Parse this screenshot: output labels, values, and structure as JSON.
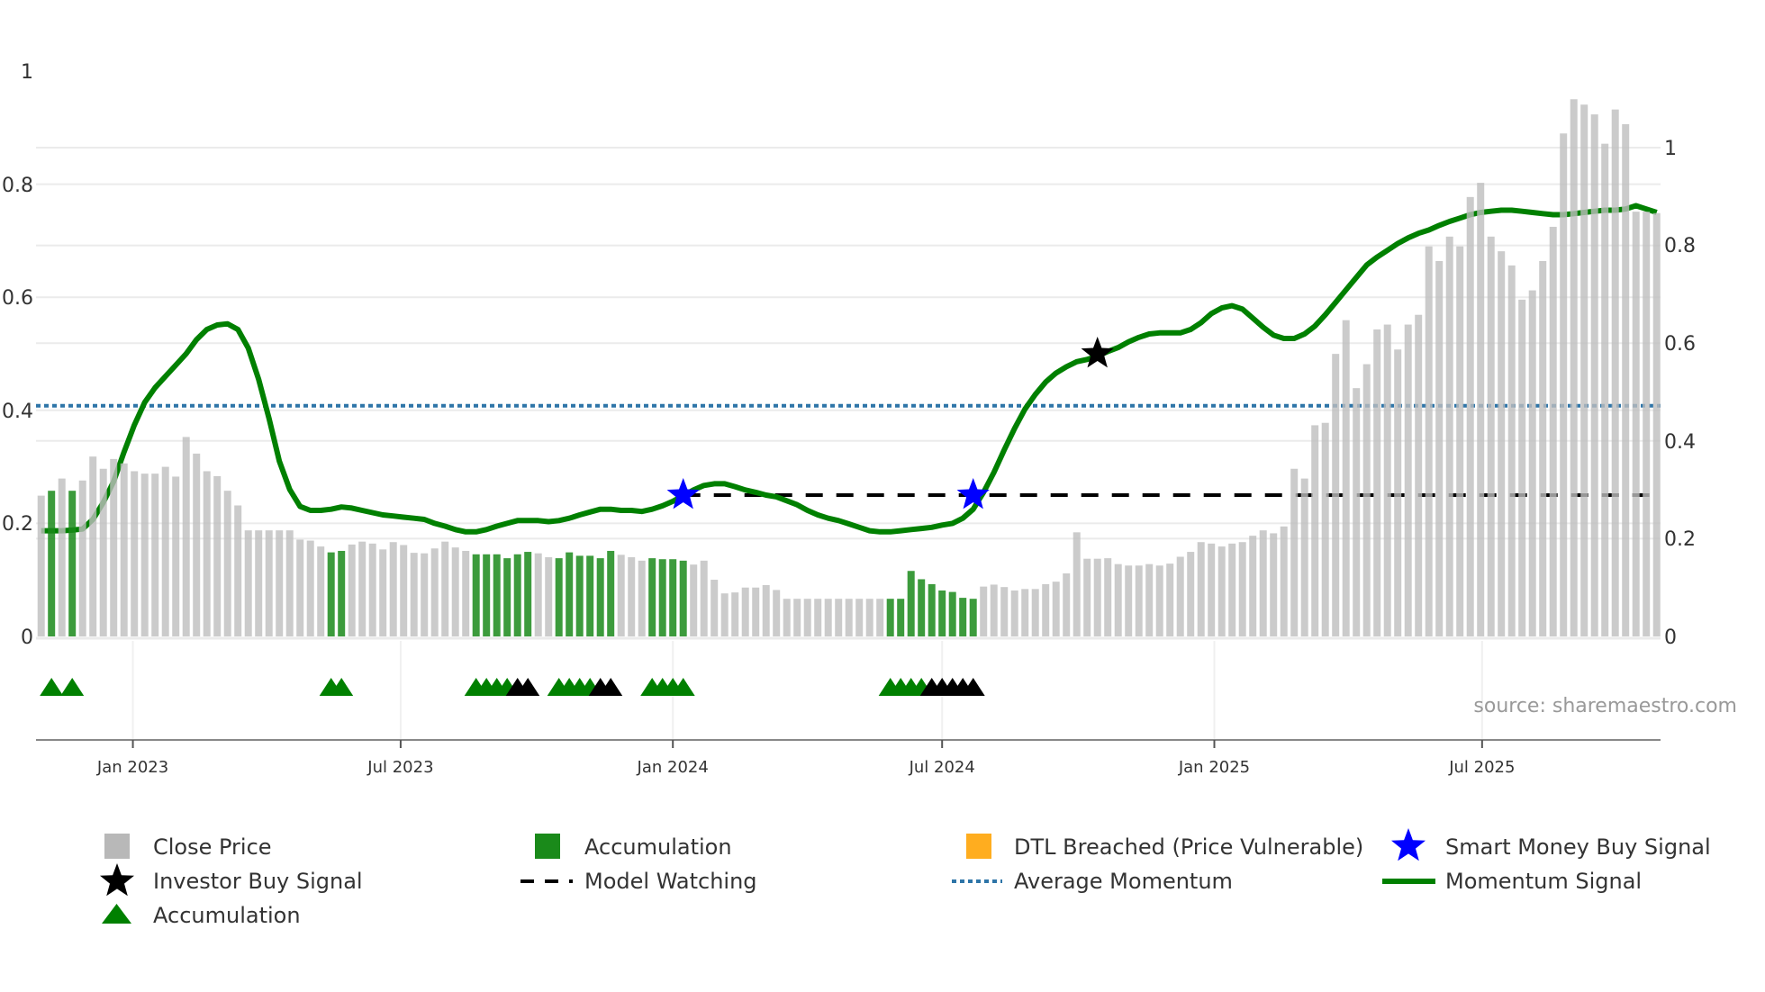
{
  "chart_data": {
    "type": "bar",
    "interval": "weekly",
    "start_date": "2022-10-31",
    "left_axis": {
      "ticks": [
        "0",
        "0.2",
        "0.4",
        "0.6",
        "0.8",
        "1"
      ],
      "range": [
        0,
        1
      ]
    },
    "right_axis": {
      "ticks": [
        "0",
        "0.2",
        "0.4",
        "0.6",
        "0.8",
        "1"
      ],
      "range": [
        0,
        1
      ]
    },
    "x_ticks": [
      {
        "label": "Jan 2023",
        "date": "2023-01-01"
      },
      {
        "label": "Jul 2023",
        "date": "2023-07-01"
      },
      {
        "label": "Jan 2024",
        "date": "2024-01-01"
      },
      {
        "label": "Jul 2024",
        "date": "2024-07-01"
      },
      {
        "label": "Jan 2025",
        "date": "2025-01-01"
      },
      {
        "label": "Jul 2025",
        "date": "2025-07-01"
      }
    ],
    "close_price": [
      0.288,
      0.298,
      0.323,
      0.298,
      0.319,
      0.368,
      0.343,
      0.363,
      0.354,
      0.338,
      0.333,
      0.333,
      0.347,
      0.327,
      0.408,
      0.374,
      0.338,
      0.328,
      0.298,
      0.268,
      0.217,
      0.217,
      0.217,
      0.217,
      0.217,
      0.198,
      0.196,
      0.184,
      0.172,
      0.175,
      0.188,
      0.194,
      0.19,
      0.178,
      0.193,
      0.187,
      0.171,
      0.17,
      0.18,
      0.194,
      0.182,
      0.175,
      0.168,
      0.168,
      0.168,
      0.16,
      0.168,
      0.173,
      0.17,
      0.162,
      0.16,
      0.172,
      0.165,
      0.165,
      0.16,
      0.175,
      0.167,
      0.162,
      0.155,
      0.16,
      0.158,
      0.158,
      0.155,
      0.147,
      0.155,
      0.116,
      0.088,
      0.09,
      0.1,
      0.1,
      0.105,
      0.095,
      0.077,
      0.077,
      0.077,
      0.077,
      0.077,
      0.077,
      0.077,
      0.077,
      0.077,
      0.077,
      0.077,
      0.077,
      0.134,
      0.117,
      0.107,
      0.094,
      0.091,
      0.079,
      0.077,
      0.102,
      0.106,
      0.101,
      0.094,
      0.097,
      0.097,
      0.107,
      0.112,
      0.129,
      0.213,
      0.159,
      0.159,
      0.16,
      0.148,
      0.145,
      0.145,
      0.148,
      0.145,
      0.149,
      0.163,
      0.173,
      0.193,
      0.19,
      0.184,
      0.19,
      0.193,
      0.206,
      0.217,
      0.211,
      0.225,
      0.343,
      0.323,
      0.432,
      0.437,
      0.578,
      0.647,
      0.508,
      0.557,
      0.628,
      0.638,
      0.587,
      0.638,
      0.658,
      0.798,
      0.768,
      0.818,
      0.798,
      0.899,
      0.928,
      0.818,
      0.788,
      0.759,
      0.689,
      0.708,
      0.768,
      0.838,
      1.029,
      1.099,
      1.088,
      1.068,
      1.008,
      1.078,
      1.048,
      0.869,
      0.869,
      0.866
    ],
    "accumulation_weeks": [
      1,
      3,
      28,
      29,
      42,
      43,
      44,
      45,
      46,
      47,
      50,
      51,
      52,
      53,
      54,
      55,
      59,
      60,
      61,
      62,
      82,
      83,
      84,
      85,
      86,
      87,
      88,
      89,
      90
    ],
    "momentum_signal": [
      0.187,
      0.187,
      0.187,
      0.188,
      0.19,
      0.207,
      0.237,
      0.274,
      0.326,
      0.374,
      0.414,
      0.44,
      0.46,
      0.48,
      0.5,
      0.525,
      0.543,
      0.551,
      0.553,
      0.543,
      0.51,
      0.455,
      0.386,
      0.31,
      0.26,
      0.23,
      0.223,
      0.223,
      0.225,
      0.229,
      0.227,
      0.223,
      0.219,
      0.215,
      0.213,
      0.211,
      0.209,
      0.207,
      0.2,
      0.195,
      0.189,
      0.185,
      0.185,
      0.189,
      0.195,
      0.2,
      0.205,
      0.205,
      0.205,
      0.203,
      0.205,
      0.209,
      0.215,
      0.22,
      0.225,
      0.225,
      0.223,
      0.223,
      0.221,
      0.225,
      0.231,
      0.239,
      0.249,
      0.259,
      0.267,
      0.27,
      0.27,
      0.265,
      0.259,
      0.255,
      0.25,
      0.247,
      0.24,
      0.233,
      0.223,
      0.215,
      0.209,
      0.205,
      0.199,
      0.193,
      0.187,
      0.185,
      0.185,
      0.187,
      0.189,
      0.191,
      0.193,
      0.197,
      0.2,
      0.209,
      0.225,
      0.255,
      0.29,
      0.33,
      0.368,
      0.402,
      0.428,
      0.45,
      0.466,
      0.477,
      0.486,
      0.49,
      0.496,
      0.504,
      0.511,
      0.521,
      0.529,
      0.535,
      0.537,
      0.537,
      0.537,
      0.543,
      0.555,
      0.571,
      0.581,
      0.585,
      0.579,
      0.563,
      0.547,
      0.533,
      0.527,
      0.527,
      0.535,
      0.549,
      0.569,
      0.591,
      0.613,
      0.635,
      0.657,
      0.671,
      0.683,
      0.695,
      0.705,
      0.713,
      0.719,
      0.727,
      0.734,
      0.74,
      0.746,
      0.75,
      0.752,
      0.754,
      0.754,
      0.752,
      0.75,
      0.748,
      0.746,
      0.746,
      0.748,
      0.75,
      0.752,
      0.754,
      0.754,
      0.756,
      0.762,
      0.756,
      0.75
    ],
    "average_momentum": 0.408,
    "model_watching": {
      "value": 0.25,
      "from_week": 62
    },
    "smart_money_buy_signals": [
      {
        "week": 62,
        "value": 0.25
      },
      {
        "week": 90,
        "value": 0.25
      }
    ],
    "investor_buy_signals": [
      {
        "week": 102,
        "value": 0.5
      }
    ],
    "accumulation_markers_green": [
      1,
      3,
      28,
      29,
      42,
      43,
      44,
      45,
      50,
      51,
      52,
      53,
      59,
      60,
      61,
      62,
      82,
      83,
      84,
      85
    ],
    "accumulation_markers_black": [
      46,
      47,
      54,
      55,
      86,
      87,
      88,
      89,
      90
    ],
    "colors": {
      "close_price": "#bebebe",
      "accumulation_bar": "#1a8a1a",
      "dtl_breached": "#ffad1f",
      "smart_money": "#0000ff",
      "investor": "#000000",
      "momentum": "#008000",
      "average_momentum": "#2e75a8",
      "model_watching": "#000000",
      "accumulation_marker": "#008000",
      "grid": "#ebebeb",
      "axis": "#888888"
    },
    "legend": [
      {
        "label": "Close Price",
        "marker": "square-gray"
      },
      {
        "label": "Accumulation",
        "marker": "square-green"
      },
      {
        "label": "DTL Breached (Price Vulnerable)",
        "marker": "square-orange"
      },
      {
        "label": "Smart Money Buy Signal",
        "marker": "star-blue"
      },
      {
        "label": "Investor Buy Signal",
        "marker": "star-black"
      },
      {
        "label": "Model Watching",
        "marker": "dash-black"
      },
      {
        "label": "Average Momentum",
        "marker": "dot-blue"
      },
      {
        "label": "Momentum Signal",
        "marker": "line-green"
      },
      {
        "label": "Accumulation",
        "marker": "triangle-green"
      }
    ],
    "legend_position": "bottom",
    "source": "source: sharemaestro.com"
  }
}
